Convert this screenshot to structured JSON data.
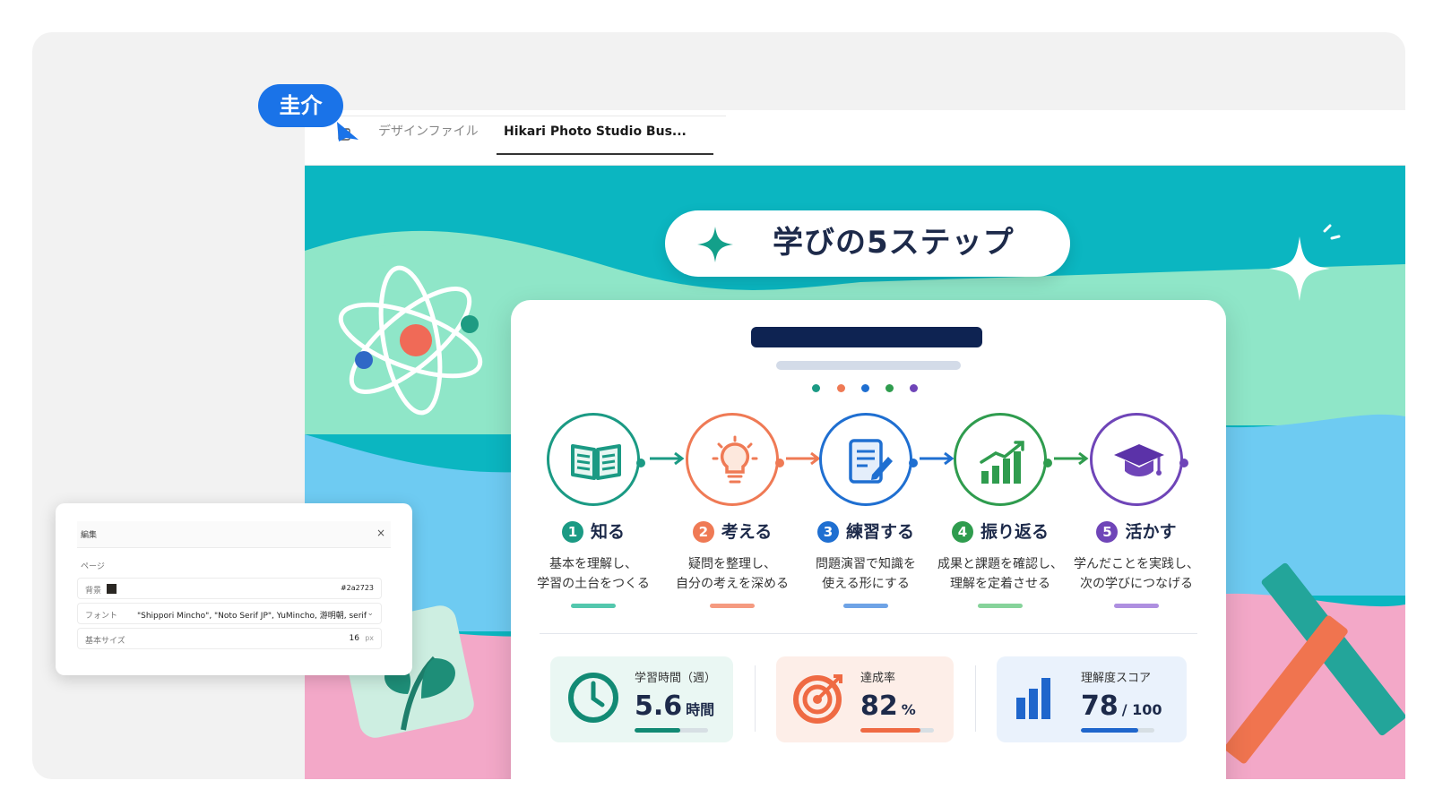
{
  "collaborator": {
    "name": "圭介"
  },
  "tabs": [
    {
      "label": "デザインファイル"
    },
    {
      "label": "Hikari Photo Studio Bus..."
    }
  ],
  "slide": {
    "title": "学びの5ステップ",
    "steps": [
      {
        "num": "1",
        "title": "知る",
        "desc1": "基本を理解し、",
        "desc2": "学習の土台をつくる",
        "color": "#1b9a84",
        "icon": "book-icon"
      },
      {
        "num": "2",
        "title": "考える",
        "desc1": "疑問を整理し、",
        "desc2": "自分の考えを深める",
        "color": "#ef7a55",
        "icon": "lightbulb-icon"
      },
      {
        "num": "3",
        "title": "練習する",
        "desc1": "問題演習で知識を",
        "desc2": "使える形にする",
        "color": "#1f6fd1",
        "icon": "notebook-pencil-icon"
      },
      {
        "num": "4",
        "title": "振り返る",
        "desc1": "成果と課題を確認し、",
        "desc2": "理解を定着させる",
        "color": "#2f9c4e",
        "icon": "growth-chart-icon"
      },
      {
        "num": "5",
        "title": "活かす",
        "desc1": "学んだことを実践し、",
        "desc2": "次の学びにつなげる",
        "color": "#6f45b8",
        "icon": "graduation-cap-icon"
      }
    ],
    "stats": [
      {
        "label": "学習時間（週）",
        "value": "5.6",
        "unit": "時間",
        "progress": 0.62,
        "color": "#128a74",
        "icon": "clock-icon"
      },
      {
        "label": "達成率",
        "value": "82",
        "unit": "%",
        "progress": 0.82,
        "color": "#ef6a43",
        "icon": "target-icon"
      },
      {
        "label": "理解度スコア",
        "value": "78",
        "unit": "/ 100",
        "progress": 0.78,
        "color": "#1f66cc",
        "icon": "bar-chart-icon"
      }
    ]
  },
  "edit_panel": {
    "title": "編集",
    "close": "×",
    "section": "ページ",
    "rows": {
      "background": {
        "label": "背景",
        "value": "#2a2723"
      },
      "font": {
        "label": "フォント",
        "value": "\"Shippori Mincho\", \"Noto Serif JP\", YuMincho, 游明朝, serif"
      },
      "base_size": {
        "label": "基本サイズ",
        "value": "16",
        "unit": "px"
      }
    }
  }
}
